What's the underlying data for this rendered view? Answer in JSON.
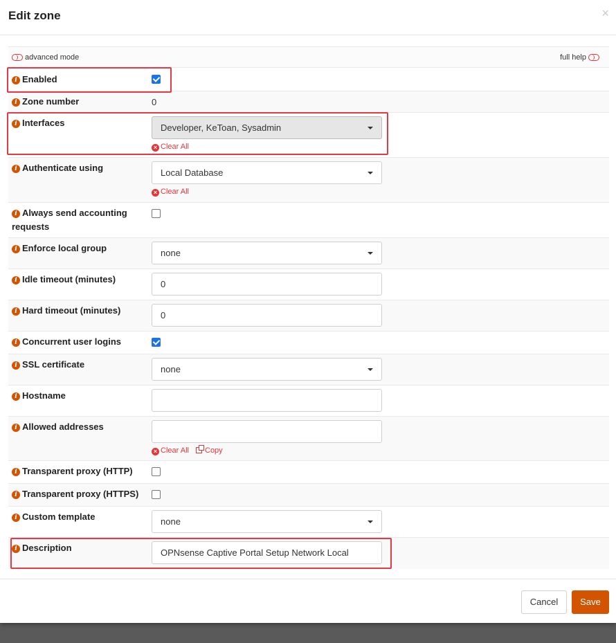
{
  "modal": {
    "title": "Edit zone",
    "close": "×"
  },
  "toolbar": {
    "advanced_mode": "advanced mode",
    "full_help": "full help"
  },
  "fields": {
    "enabled": {
      "label": "Enabled",
      "checked": true
    },
    "zone_number": {
      "label": "Zone number",
      "value": "0"
    },
    "interfaces": {
      "label": "Interfaces",
      "value": "Developer, KeToan, Sysadmin",
      "clear": "Clear All"
    },
    "authenticate": {
      "label": "Authenticate using",
      "value": "Local Database",
      "clear": "Clear All"
    },
    "accounting": {
      "label": "Always send accounting requests",
      "checked": false
    },
    "enforce_group": {
      "label": "Enforce local group",
      "value": "none"
    },
    "idle_timeout": {
      "label": "Idle timeout (minutes)",
      "value": "0"
    },
    "hard_timeout": {
      "label": "Hard timeout (minutes)",
      "value": "0"
    },
    "concurrent": {
      "label": "Concurrent user logins",
      "checked": true
    },
    "ssl_cert": {
      "label": "SSL certificate",
      "value": "none"
    },
    "hostname": {
      "label": "Hostname",
      "value": ""
    },
    "allowed_addresses": {
      "label": "Allowed addresses",
      "value": "",
      "clear": "Clear All",
      "copy": "Copy"
    },
    "proxy_http": {
      "label": "Transparent proxy (HTTP)",
      "checked": false
    },
    "proxy_https": {
      "label": "Transparent proxy (HTTPS)",
      "checked": false
    },
    "custom_template": {
      "label": "Custom template",
      "value": "none"
    },
    "description": {
      "label": "Description",
      "value": "OPNsense Captive Portal Setup Network Local"
    }
  },
  "footer": {
    "cancel": "Cancel",
    "save": "Save"
  },
  "colors": {
    "accent": "#d35400",
    "highlight": "#e63946",
    "link_red": "#e2363a",
    "checkbox_blue": "#1a73e8"
  }
}
